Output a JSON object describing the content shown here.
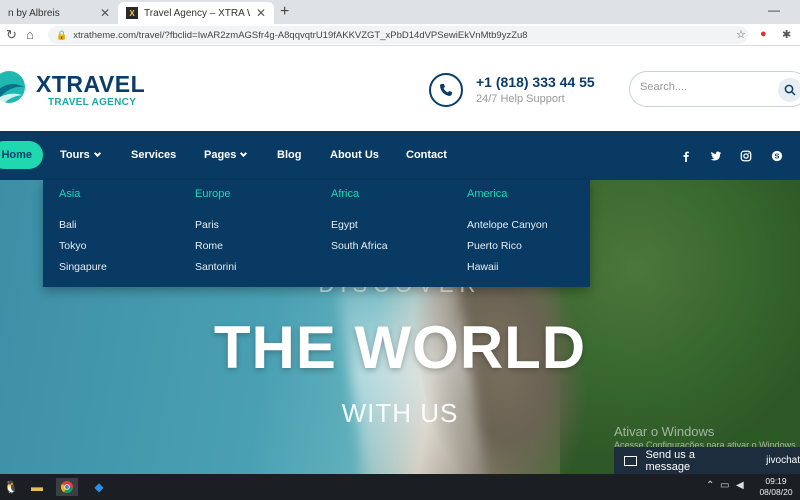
{
  "browser": {
    "tabs": [
      {
        "title": "n by Albreis"
      },
      {
        "title": "Travel Agency – XTRA WordPres"
      }
    ],
    "url": "xtratheme.com/travel/?fbclid=IwAR2zmAGSfr4g-A8qqvqtrU19fAKKVZGT_xPbD14dVPSewiEkVnMtb9yzZu8"
  },
  "header": {
    "logo_title": "XTRAVEL",
    "logo_subtitle": "TRAVEL AGENCY",
    "phone": "+1 (818) 333 44 55",
    "phone_help": "24/7 Help Support",
    "search_placeholder": "Search...."
  },
  "nav": {
    "items": [
      {
        "label": "Home"
      },
      {
        "label": "Tours"
      },
      {
        "label": "Services"
      },
      {
        "label": "Pages"
      },
      {
        "label": "Blog"
      },
      {
        "label": "About Us"
      },
      {
        "label": "Contact"
      }
    ],
    "social": [
      "facebook-icon",
      "twitter-icon",
      "instagram-icon",
      "skype-icon"
    ]
  },
  "mega_menu": {
    "columns": [
      {
        "heading": "Asia",
        "links": [
          "Bali",
          "Tokyo",
          "Singapure"
        ]
      },
      {
        "heading": "Europe",
        "links": [
          "Paris",
          "Rome",
          "Santorini"
        ]
      },
      {
        "heading": "Africa",
        "links": [
          "Egypt",
          "South Africa"
        ]
      },
      {
        "heading": "America",
        "links": [
          "Antelope Canyon",
          "Puerto Rico",
          "Hawaii"
        ]
      }
    ]
  },
  "hero": {
    "discover": "DISCOVER",
    "title": "THE WORLD",
    "subtitle": "WITH US"
  },
  "watermark": {
    "line1": "Ativar o Windows",
    "line2": "Acesse Configurações para ativar o Windows."
  },
  "chat": {
    "label": "Send us a message",
    "brand": "jivochat"
  },
  "taskbar": {
    "time": "09:19",
    "date": "08/08/20"
  },
  "colors": {
    "navy": "#083a63",
    "accent": "#1fd8b0",
    "logo": "#0b3d6b"
  }
}
